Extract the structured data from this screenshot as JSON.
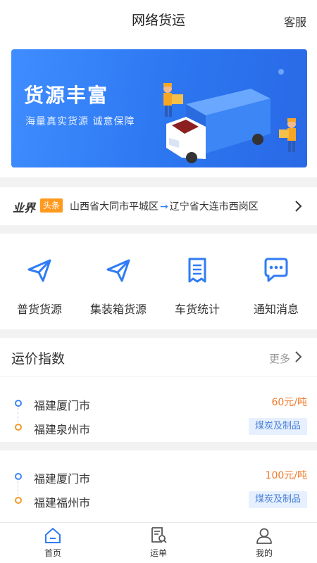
{
  "header": {
    "title": "网络货运",
    "service_label": "客服"
  },
  "banner": {
    "headline": "货源丰富",
    "subtitle": "海量真实货源  诚意保障"
  },
  "news": {
    "logo_text": "业界",
    "tag": "头条",
    "origin": "山西省大同市平城区",
    "arrow": "→",
    "destination": "辽宁省大连市西岗区"
  },
  "quick_menu": [
    {
      "label": "普货货源",
      "icon": "paper-plane-icon"
    },
    {
      "label": "集装箱货源",
      "icon": "paper-plane-icon"
    },
    {
      "label": "车货统计",
      "icon": "receipt-icon"
    },
    {
      "label": "通知消息",
      "icon": "chat-bubble-icon"
    }
  ],
  "freight_index": {
    "title": "运价指数",
    "more_label": "更多",
    "rows": [
      {
        "from": "福建厦门市",
        "to": "福建泉州市",
        "price": "60元/吨",
        "category": "煤炭及制品"
      },
      {
        "from": "福建厦门市",
        "to": "福建福州市",
        "price": "100元/吨",
        "category": "煤炭及制品"
      }
    ]
  },
  "tabbar": [
    {
      "label": "首页",
      "icon": "home-icon",
      "active": true
    },
    {
      "label": "运单",
      "icon": "waybill-search-icon",
      "active": false
    },
    {
      "label": "我的",
      "icon": "user-icon",
      "active": false
    }
  ],
  "colors": {
    "primary": "#2f7cf6",
    "accent_orange": "#f07a2c",
    "banner_blue": "#2c76f0",
    "tag_orange": "#ff9a1f"
  }
}
